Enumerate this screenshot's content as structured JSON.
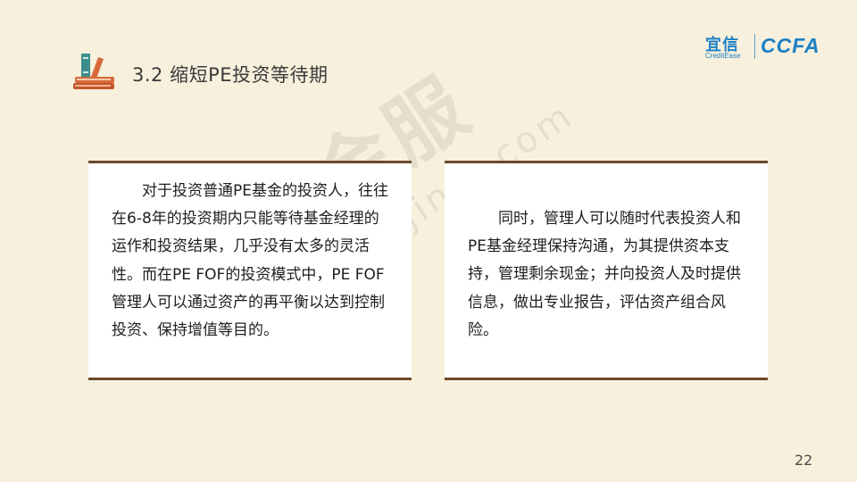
{
  "header": {
    "title": "3.2 缩短PE投资等待期"
  },
  "logo": {
    "cn": "宜信",
    "en": "CreditEase",
    "ccfa": "CCFA"
  },
  "watermark": {
    "cn": "大圣从金服",
    "url": "dashengcongjinfu.com"
  },
  "cards": [
    {
      "text": "对于投资普通PE基金的投资人，往往在6-8年的投资期内只能等待基金经理的运作和投资结果，几乎没有太多的灵活性。而在PE FOF的投资模式中，PE FOF管理人可以通过资产的再平衡以达到控制投资、保持增值等目的。"
    },
    {
      "text": "同时，管理人可以随时代表投资人和PE基金经理保持沟通，为其提供资本支持，管理剩余现金；并向投资人及时提供信息，做出专业报告，评估资产组合风险。"
    }
  ],
  "footer": {
    "page_number": "22"
  },
  "colors": {
    "background": "#f7f0dc",
    "card_border": "#6b4a2a",
    "logo_blue": "#1c7fc4",
    "icon_orange": "#d76a3c",
    "icon_teal": "#3a8f8c"
  }
}
